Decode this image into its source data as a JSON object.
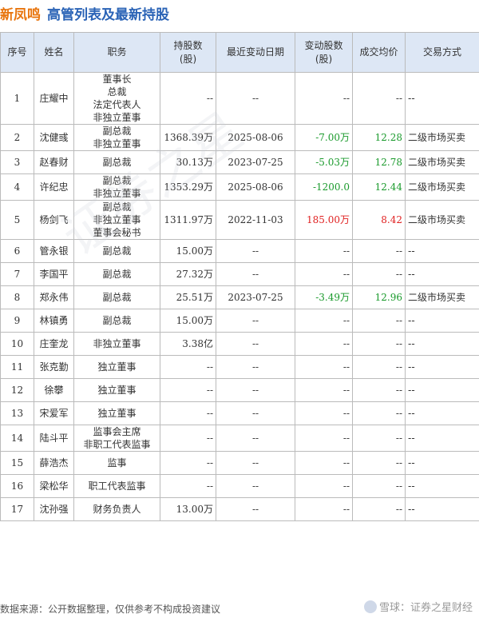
{
  "header": {
    "company": "新凤鸣",
    "title": "高管列表及最新持股"
  },
  "table": {
    "columns": [
      "序号",
      "姓名",
      "职务",
      "持股数\n(股)",
      "最近变动日期",
      "变动股数\n(股)",
      "成交均价",
      "交易方式"
    ],
    "rows": [
      {
        "idx": "1",
        "name": "庄耀中",
        "titles": [
          "董事长",
          "总裁",
          "法定代表人",
          "非独立董事"
        ],
        "shares": "--",
        "date": "--",
        "change": "--",
        "change_sign": "",
        "price": "--",
        "price_sign": "",
        "way": "--"
      },
      {
        "idx": "2",
        "name": "沈健彧",
        "titles": [
          "副总裁",
          "非独立董事"
        ],
        "shares": "1368.39万",
        "date": "2025-08-06",
        "change": "-7.00万",
        "change_sign": "neg",
        "price": "12.28",
        "price_sign": "neg",
        "way": "二级市场买卖"
      },
      {
        "idx": "3",
        "name": "赵春财",
        "titles": [
          "副总裁"
        ],
        "shares": "30.13万",
        "date": "2023-07-25",
        "change": "-5.03万",
        "change_sign": "neg",
        "price": "12.78",
        "price_sign": "neg",
        "way": "二级市场买卖"
      },
      {
        "idx": "4",
        "name": "许纪忠",
        "titles": [
          "副总裁",
          "非独立董事"
        ],
        "shares": "1353.29万",
        "date": "2025-08-06",
        "change": "-1200.0",
        "change_sign": "neg",
        "price": "12.44",
        "price_sign": "neg",
        "way": "二级市场买卖"
      },
      {
        "idx": "5",
        "name": "杨剑飞",
        "titles": [
          "副总裁",
          "非独立董事",
          "董事会秘书"
        ],
        "shares": "1311.97万",
        "date": "2022-11-03",
        "change": "185.00万",
        "change_sign": "pos",
        "price": "8.42",
        "price_sign": "pos",
        "way": "二级市场买卖"
      },
      {
        "idx": "6",
        "name": "管永银",
        "titles": [
          "副总裁"
        ],
        "shares": "15.00万",
        "date": "--",
        "change": "--",
        "change_sign": "",
        "price": "--",
        "price_sign": "",
        "way": "--"
      },
      {
        "idx": "7",
        "name": "李国平",
        "titles": [
          "副总裁"
        ],
        "shares": "27.32万",
        "date": "--",
        "change": "--",
        "change_sign": "",
        "price": "--",
        "price_sign": "",
        "way": "--"
      },
      {
        "idx": "8",
        "name": "郑永伟",
        "titles": [
          "副总裁"
        ],
        "shares": "25.51万",
        "date": "2023-07-25",
        "change": "-3.49万",
        "change_sign": "neg",
        "price": "12.96",
        "price_sign": "neg",
        "way": "二级市场买卖"
      },
      {
        "idx": "9",
        "name": "林镇勇",
        "titles": [
          "副总裁"
        ],
        "shares": "15.00万",
        "date": "--",
        "change": "--",
        "change_sign": "",
        "price": "--",
        "price_sign": "",
        "way": "--"
      },
      {
        "idx": "10",
        "name": "庄奎龙",
        "titles": [
          "非独立董事"
        ],
        "shares": "3.38亿",
        "date": "--",
        "change": "--",
        "change_sign": "",
        "price": "--",
        "price_sign": "",
        "way": "--"
      },
      {
        "idx": "11",
        "name": "张克勤",
        "titles": [
          "独立董事"
        ],
        "shares": "--",
        "date": "--",
        "change": "--",
        "change_sign": "",
        "price": "--",
        "price_sign": "",
        "way": "--"
      },
      {
        "idx": "12",
        "name": "徐攀",
        "titles": [
          "独立董事"
        ],
        "shares": "--",
        "date": "--",
        "change": "--",
        "change_sign": "",
        "price": "--",
        "price_sign": "",
        "way": "--"
      },
      {
        "idx": "13",
        "name": "宋爱军",
        "titles": [
          "独立董事"
        ],
        "shares": "--",
        "date": "--",
        "change": "--",
        "change_sign": "",
        "price": "--",
        "price_sign": "",
        "way": "--"
      },
      {
        "idx": "14",
        "name": "陆斗平",
        "titles": [
          "监事会主席",
          "非职工代表监事"
        ],
        "shares": "--",
        "date": "--",
        "change": "--",
        "change_sign": "",
        "price": "--",
        "price_sign": "",
        "way": "--"
      },
      {
        "idx": "15",
        "name": "薛浩杰",
        "titles": [
          "监事"
        ],
        "shares": "--",
        "date": "--",
        "change": "--",
        "change_sign": "",
        "price": "--",
        "price_sign": "",
        "way": "--"
      },
      {
        "idx": "16",
        "name": "梁松华",
        "titles": [
          "职工代表监事"
        ],
        "shares": "--",
        "date": "--",
        "change": "--",
        "change_sign": "",
        "price": "--",
        "price_sign": "",
        "way": "--"
      },
      {
        "idx": "17",
        "name": "沈孙强",
        "titles": [
          "财务负责人"
        ],
        "shares": "13.00万",
        "date": "--",
        "change": "--",
        "change_sign": "",
        "price": "--",
        "price_sign": "",
        "way": "--"
      }
    ]
  },
  "footer": {
    "source": "数据来源：公开数据整理，仅供参考不构成投资建议",
    "brand": "雪球：证券之星财经"
  },
  "colors": {
    "company": "#e8750e",
    "title": "#2a63b6",
    "header_bg": "#dde7f5",
    "negative": "#1a9a2c",
    "positive": "#e02020"
  },
  "watermark": "证券之星"
}
